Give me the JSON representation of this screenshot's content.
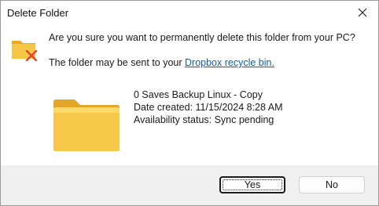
{
  "window": {
    "title": "Delete Folder"
  },
  "message": {
    "question": "Are you sure you want to permanently delete this folder from your PC?",
    "sub_prefix": "The folder may be sent to your ",
    "sub_link": "Dropbox recycle bin."
  },
  "folder": {
    "name": "0 Saves Backup Linux - Copy",
    "date_created": "Date created: 11/15/2024 8:28 AM",
    "availability": "Availability status: Sync pending"
  },
  "buttons": {
    "yes": "Yes",
    "no": "No"
  },
  "icons": {
    "warning": "folder-delete-icon",
    "folder": "folder-icon",
    "close": "close-icon"
  },
  "colors": {
    "link": "#0a5fb4",
    "folder": "#f5c242",
    "delete_x": "#e0452b"
  }
}
